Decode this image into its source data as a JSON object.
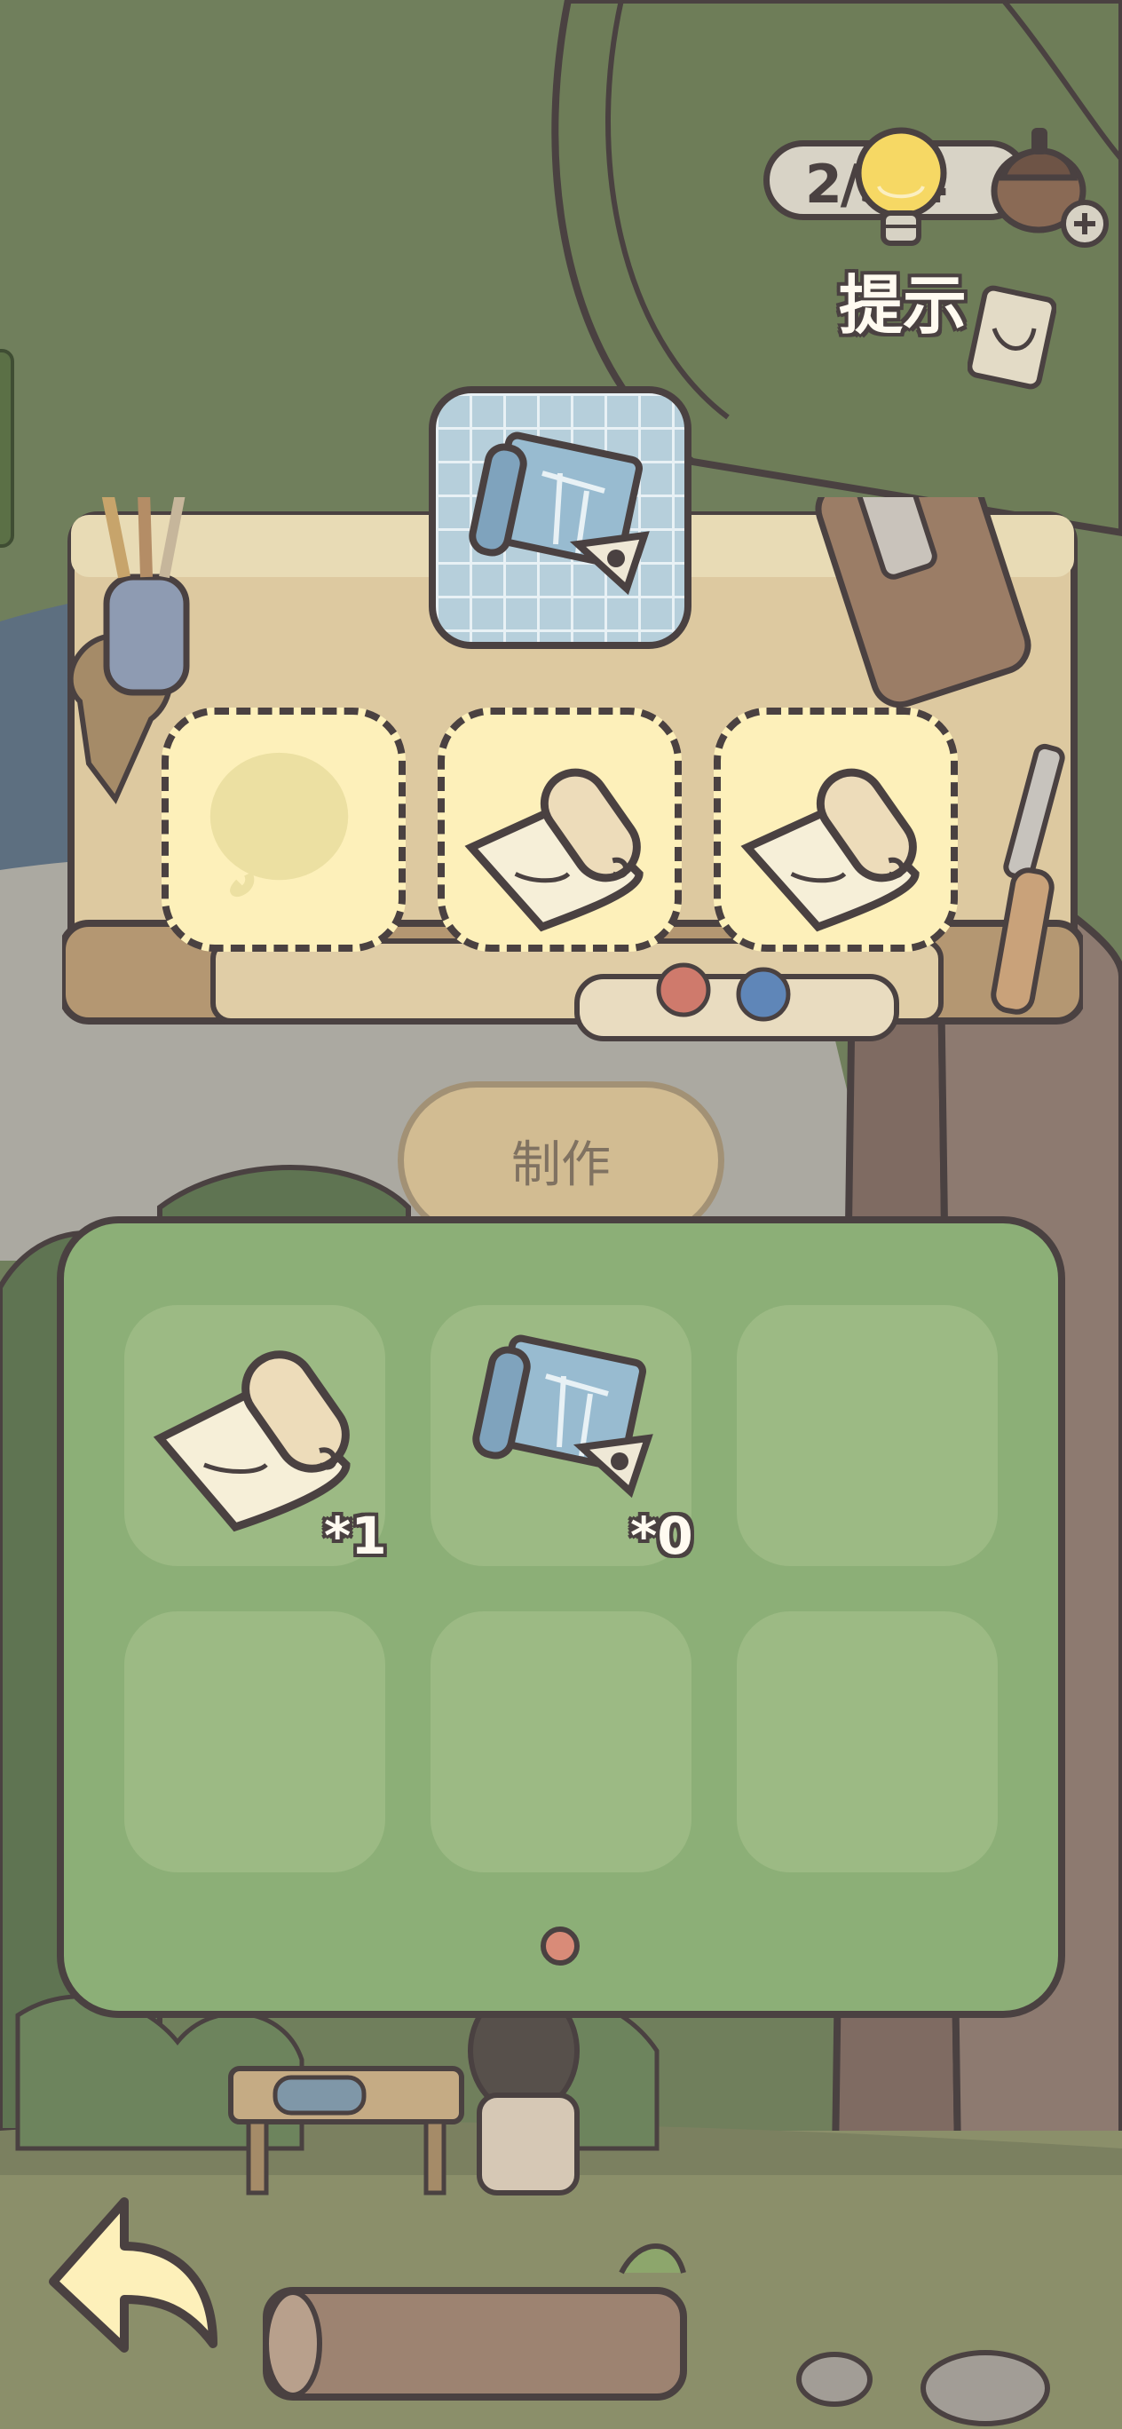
{
  "hint": {
    "count_text": "2/5/4",
    "label": "提示"
  },
  "crafting": {
    "target_item": "blueprint-scroll",
    "ingredient_slots": [
      {
        "item": "empty",
        "hint": "leaf-silhouette"
      },
      {
        "item": "paper-scroll"
      },
      {
        "item": "paper-scroll"
      }
    ],
    "make_button_label": "制作"
  },
  "inventory": {
    "items": [
      {
        "item": "paper-scroll",
        "count": "*1"
      },
      {
        "item": "blueprint-scroll",
        "count": "*0"
      }
    ],
    "page": 1
  },
  "colors": {
    "outline": "#4a4141",
    "panel_green": "#8caf77",
    "slot_yellow": "#fdf0ba",
    "blueprint_blue": "#b6cfdb"
  }
}
